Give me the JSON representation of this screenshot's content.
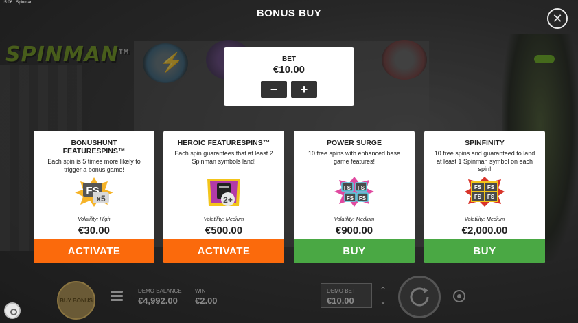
{
  "status_bar": {
    "time_app": "15:06 · Spinman"
  },
  "background": {
    "logo": "SPINMAN",
    "logo_tm": "TM"
  },
  "header": {
    "title": "BONUS BUY"
  },
  "bet": {
    "label": "BET",
    "value": "€10.00",
    "minus_label": "−",
    "plus_label": "+"
  },
  "cards": [
    {
      "title": "BONUSHUNT FEATURESPINS™",
      "description": "Each spin is 5 times more likely to trigger a bonus game!",
      "art_icon": "fs-x5-badge-icon",
      "volatility": "Volatility: High",
      "price": "€30.00",
      "action": "ACTIVATE",
      "action_color": "#fb6a0c"
    },
    {
      "title": "HEROIC FEATURESPINS™",
      "description": "Each spin guarantees that at least 2 Spinman symbols land!",
      "art_icon": "spinman-2plus-badge-icon",
      "volatility": "Volatility: Medium",
      "price": "€500.00",
      "action": "ACTIVATE",
      "action_color": "#fb6a0c"
    },
    {
      "title": "POWER SURGE",
      "description": "10 free spins with enhanced base game features!",
      "art_icon": "fs-burst-badge-icon",
      "volatility": "Volatility: Medium",
      "price": "€900.00",
      "action": "BUY",
      "action_color": "#4aa844"
    },
    {
      "title": "SPINFINITY",
      "description": "10 free spins and guaranteed to land at least 1 Spinman symbol on each spin!",
      "art_icon": "fs-grid-badge-icon",
      "volatility": "Volatility: Medium",
      "price": "€2,000.00",
      "action": "BUY",
      "action_color": "#4aa844"
    }
  ],
  "bottom": {
    "buy_bonus": "BUY BONUS",
    "balance_label": "DEMO BALANCE",
    "balance_value": "€4,992.00",
    "win_label": "WIN",
    "win_value": "€2.00",
    "demo_bet_label": "DEMO BET",
    "demo_bet_value": "€10.00"
  }
}
